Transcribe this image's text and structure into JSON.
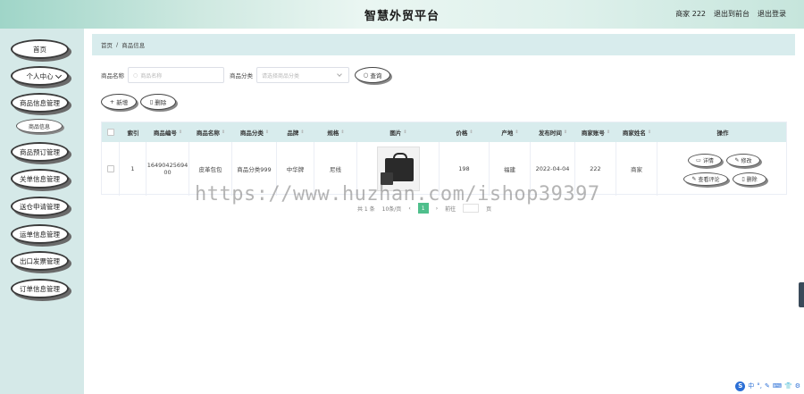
{
  "header": {
    "title": "智慧外贸平台",
    "user": "商家 222",
    "back_admin": "退出到前台",
    "logout": "退出登录"
  },
  "sidebar": {
    "items": [
      {
        "label": "首页"
      },
      {
        "label": "个人中心"
      },
      {
        "label": "商品信息管理"
      },
      {
        "label": "商品信息"
      },
      {
        "label": "商品预订管理"
      },
      {
        "label": "关单信息管理"
      },
      {
        "label": "送仓申请管理"
      },
      {
        "label": "运单信息管理"
      },
      {
        "label": "出口发票管理"
      },
      {
        "label": "订单信息管理"
      }
    ]
  },
  "breadcrumb": {
    "home": "首页",
    "sep": "/",
    "current": "商品信息"
  },
  "search": {
    "name_label": "商品名称",
    "name_placeholder": "商品名称",
    "category_label": "商品分类",
    "category_placeholder": "请选择商品分类",
    "query_button": "查询"
  },
  "actions": {
    "add": "新增",
    "delete": "删除"
  },
  "table": {
    "headers": [
      "",
      "索引",
      "商品编号",
      "商品名称",
      "商品分类",
      "品牌",
      "规格",
      "图片",
      "价格",
      "产地",
      "发布时间",
      "商家账号",
      "商家姓名",
      "操作"
    ],
    "rows": [
      {
        "index": "1",
        "code_line1": "16490425694",
        "code_line2": "00",
        "name": "皮革包包",
        "category": "商品分类999",
        "brand": "中华牌",
        "spec": "尼线",
        "price": "198",
        "origin": "福建",
        "date": "2022-04-04",
        "account": "222",
        "merchant": "商家",
        "ops": {
          "detail": "详情",
          "edit": "修改",
          "review": "查看评论",
          "delete": "删除"
        }
      }
    ]
  },
  "pagination": {
    "total": "共 1 条",
    "page_size": "10条/页",
    "current": "1",
    "goto": "前往",
    "page_unit": "页"
  },
  "watermark": "https://www.huzhan.com/ishop39397",
  "ime": {
    "items": [
      "中",
      "°,",
      "✎",
      "⌨",
      "👕",
      "⚙"
    ]
  }
}
